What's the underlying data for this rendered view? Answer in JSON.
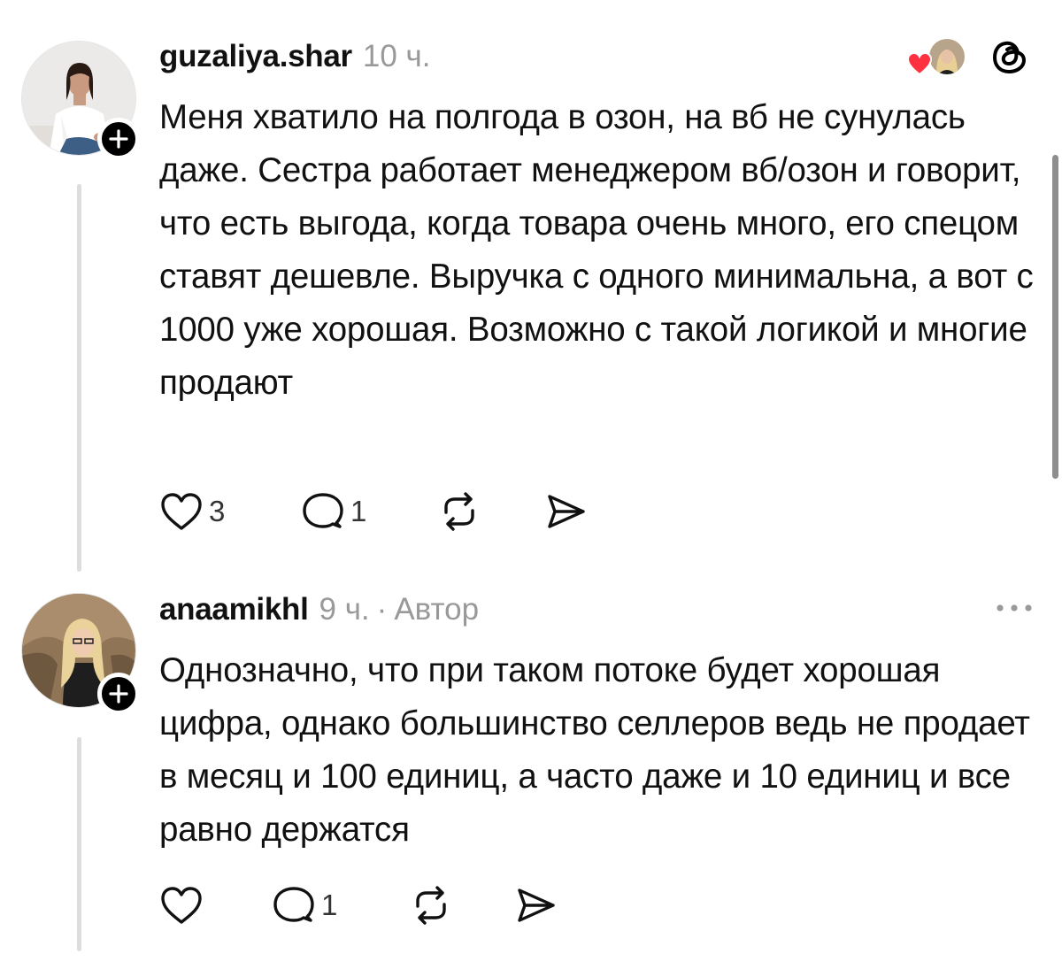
{
  "posts": [
    {
      "username": "guzaliya.shar",
      "time": "10 ч.",
      "text": "Меня хватило на полгода в озон, на вб не сунулась даже. Сестра работает менеджером вб/озон и говорит, что есть выгода, когда товара очень много, его спецом ставят дешевле. Выручка с одного минимальна, а вот с 1000 уже хорошая. Возможно с такой логикой и многие продают",
      "likes": "3",
      "replies": "1"
    },
    {
      "username": "anaamikhl",
      "time": "9 ч.",
      "separator": "·",
      "author_label": "Автор",
      "text": "Однозначно, что при таком потоке будет хорошая цифра, однако большинство селлеров ведь не продает в месяц и 100 единиц, а часто даже и 10 единиц и все равно держатся",
      "replies": "1"
    }
  ],
  "icons": {
    "like": "heart-icon",
    "reply": "comment-icon",
    "repost": "repost-icon",
    "share": "send-icon",
    "follow": "plus-icon",
    "app": "threads-logo-icon",
    "more": "more-dots-icon"
  },
  "colors": {
    "text": "#111111",
    "meta": "#999999",
    "thread_line": "#dddddd",
    "liked_heart": "#ff3040",
    "badge": "#000000"
  }
}
